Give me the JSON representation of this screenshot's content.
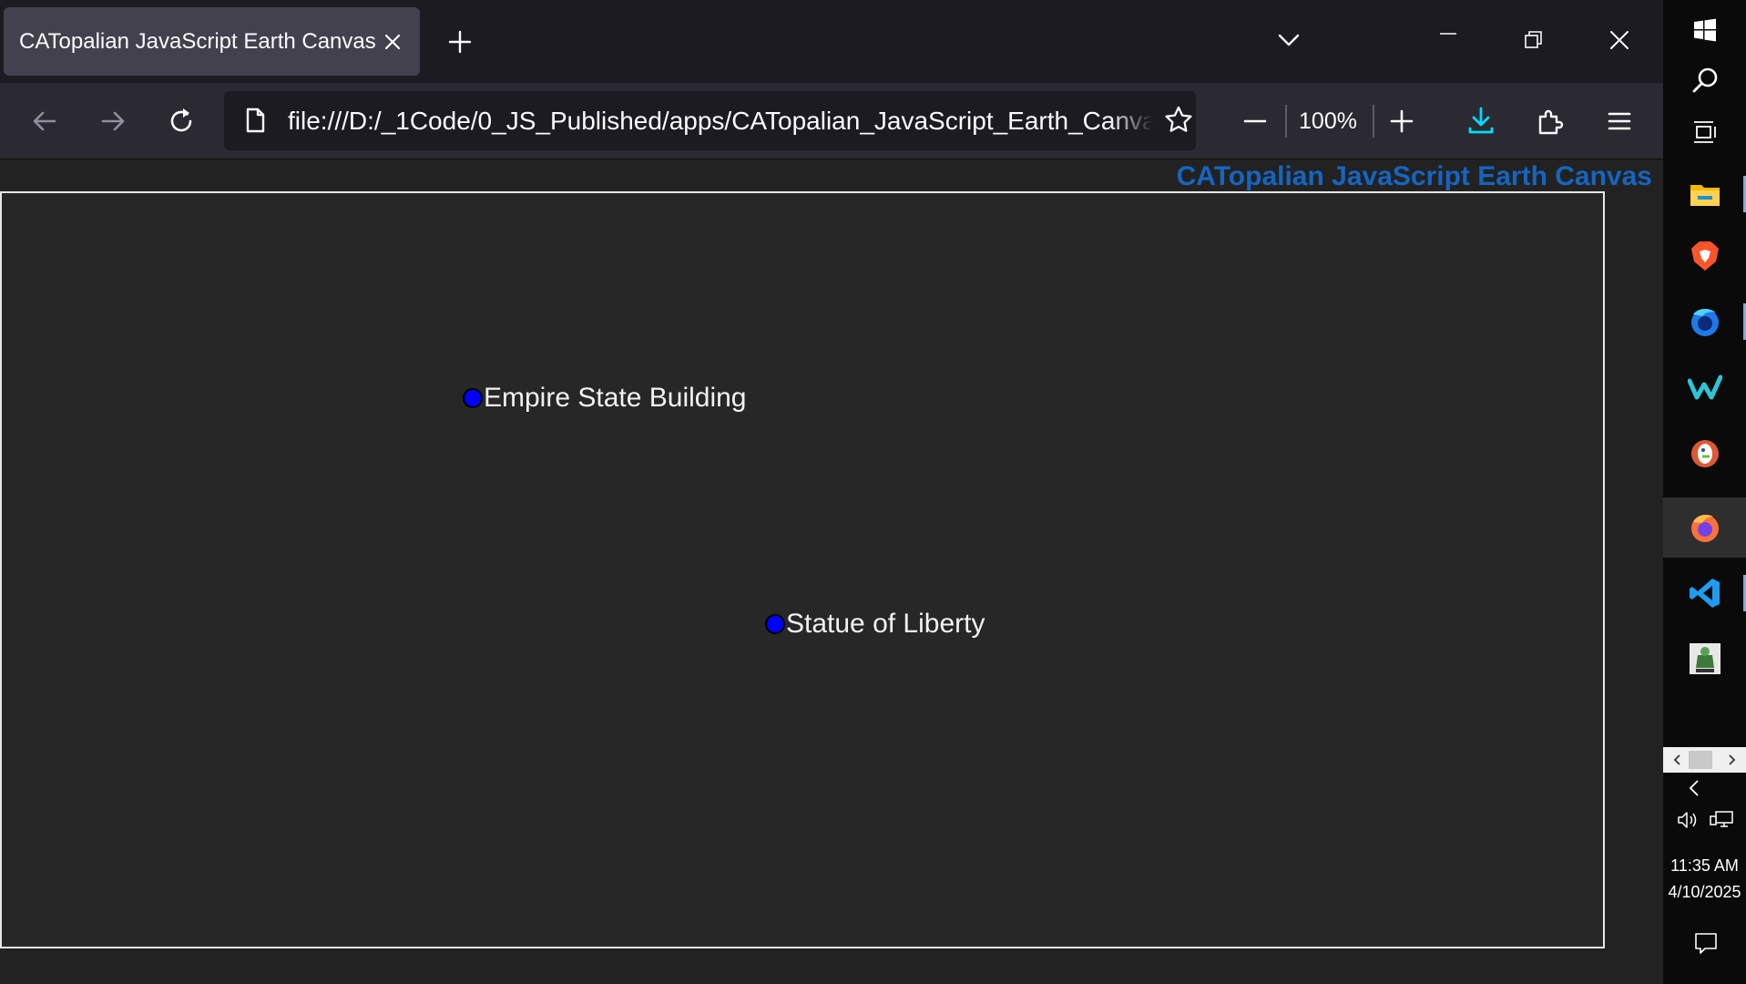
{
  "browser": {
    "tab": {
      "title": "CATopalian JavaScript Earth Canvas"
    },
    "url": "file:///D:/_1Code/0_JS_Published/apps/CATopalian_JavaScript_Earth_Canvas/CATopalian_JavaScript_Earth_Canvas.html",
    "zoom_level": "100%",
    "icons": [
      "close-tab-icon",
      "plus-icon",
      "chevron-down-icon",
      "minimize-icon",
      "restore-icon",
      "close-icon",
      "back-arrow-icon",
      "forward-arrow-icon",
      "reload-icon",
      "page-icon",
      "star-icon",
      "minus-icon",
      "download-icon",
      "puzzle-icon",
      "hamburger-menu-icon"
    ]
  },
  "page": {
    "heading": "CATopalian JavaScript Earth Canvas",
    "heading_color": "#1565c0",
    "canvas_background": "#272727",
    "marker_color": "#0000ff",
    "markers": [
      {
        "label": "Empire State Building"
      },
      {
        "label": "Statue of Liberty"
      }
    ]
  },
  "taskbar": {
    "icons": [
      "windows-start-icon",
      "search-icon",
      "task-view-icon",
      "file-explorer-icon",
      "brave-icon",
      "firefox-developer-icon",
      "windsurf-icon",
      "duckduckgo-icon",
      "firefox-icon",
      "vscode-icon",
      "app-icon"
    ],
    "clock": {
      "time": "11:35 AM",
      "date": "4/10/2025"
    }
  }
}
